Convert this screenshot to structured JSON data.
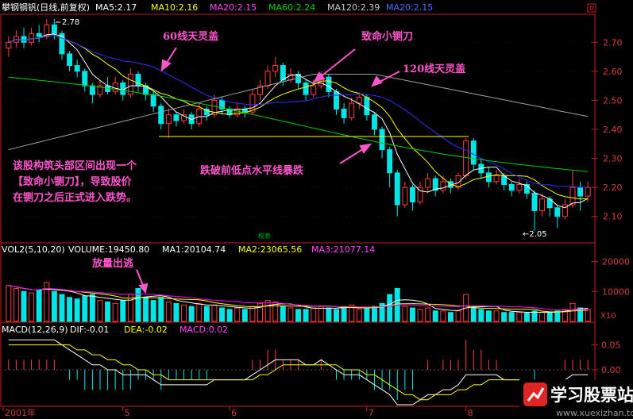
{
  "header": {
    "stock": "攀钢钢钒(日线,前复权)",
    "ma5": "MA5:2.17",
    "ma10": "MA10:2.16",
    "ma20": "MA20:2.15",
    "ma60": "MA60:2.24",
    "ma120": "MA120:2.39",
    "ma20b": "MA20:2.15"
  },
  "volume_header": {
    "label": "VOL2(5,10,20)",
    "volume": "VOLUME:19450.80",
    "ma1": "MA1:20104.74",
    "ma2": "MA2:23065.56",
    "ma3": "MA3:21077.14"
  },
  "macd_header": {
    "label": "MACD(12,26,9)",
    "dif": "DIF:-0.01",
    "dea": "DEA:-0.02",
    "macd": "MACD:0.02"
  },
  "annotations": {
    "a1": "60线天灵盖",
    "a2": "致命小铡刀",
    "a3": "120线天灵盖",
    "a4": "跌破前低点水平线暴跌",
    "note1": "该股构筑头部区间出现一个",
    "note2": "【致命小铡刀】，导致股价",
    "note3": "在铡刀之后正式进入跌势。",
    "vol_note": "放量出逃",
    "high_label": "2.78",
    "low_label": "←2.05",
    "small_mark": "权息",
    "vol_unit": "X10"
  },
  "axis": {
    "price_ticks": [
      "2.70",
      "2.60",
      "2.50",
      "2.40",
      "2.30",
      "2.20",
      "2.10"
    ],
    "vol_ticks": [
      "20000",
      "10000"
    ],
    "macd_ticks": [
      "0.05",
      "0.00",
      "-0.05"
    ],
    "months": [
      "2001年",
      "5",
      "6",
      "7",
      "8",
      "9"
    ]
  },
  "watermark": {
    "title": "学习股票站",
    "url": "www.xuexizhan.top"
  },
  "colors": {
    "bg": "#000000",
    "up": "#ff3c3c",
    "down": "#00e6e6",
    "ma5": "#ffffff",
    "ma10": "#ffff00",
    "ma20": "#ff00ff",
    "ma60": "#00d000",
    "ma120": "#a0a0a0",
    "ma20b": "#3030ff",
    "annotation": "#ff55cc",
    "axis": "#c81e1e"
  },
  "chart_data": {
    "type": "candlestick",
    "price_range": [
      2.02,
      2.78
    ],
    "volume_range": [
      0,
      22000
    ],
    "macd_range": [
      -0.07,
      0.07
    ],
    "candles": [
      [
        2.68,
        2.7,
        2.72,
        2.65
      ],
      [
        2.7,
        2.72,
        2.74,
        2.68
      ],
      [
        2.72,
        2.7,
        2.75,
        2.68
      ],
      [
        2.7,
        2.73,
        2.75,
        2.69
      ],
      [
        2.73,
        2.72,
        2.76,
        2.7
      ],
      [
        2.72,
        2.76,
        2.78,
        2.71
      ],
      [
        2.76,
        2.73,
        2.78,
        2.71
      ],
      [
        2.73,
        2.66,
        2.74,
        2.64
      ],
      [
        2.66,
        2.62,
        2.67,
        2.6
      ],
      [
        2.62,
        2.6,
        2.64,
        2.58
      ],
      [
        2.6,
        2.55,
        2.61,
        2.53
      ],
      [
        2.55,
        2.52,
        2.56,
        2.49
      ],
      [
        2.52,
        2.55,
        2.57,
        2.51
      ],
      [
        2.55,
        2.53,
        2.58,
        2.52
      ],
      [
        2.53,
        2.56,
        2.58,
        2.52
      ],
      [
        2.56,
        2.52,
        2.57,
        2.5
      ],
      [
        2.52,
        2.59,
        2.61,
        2.51
      ],
      [
        2.59,
        2.55,
        2.6,
        2.53
      ],
      [
        2.55,
        2.52,
        2.56,
        2.5
      ],
      [
        2.52,
        2.48,
        2.53,
        2.46
      ],
      [
        2.48,
        2.42,
        2.49,
        2.4
      ],
      [
        2.42,
        2.45,
        2.47,
        2.37
      ],
      [
        2.45,
        2.43,
        2.46,
        2.41
      ],
      [
        2.43,
        2.45,
        2.47,
        2.42
      ],
      [
        2.45,
        2.42,
        2.46,
        2.4
      ],
      [
        2.42,
        2.47,
        2.49,
        2.41
      ],
      [
        2.47,
        2.45,
        2.48,
        2.43
      ],
      [
        2.45,
        2.5,
        2.52,
        2.44
      ],
      [
        2.5,
        2.47,
        2.51,
        2.45
      ],
      [
        2.47,
        2.45,
        2.48,
        2.44
      ],
      [
        2.45,
        2.47,
        2.49,
        2.44
      ],
      [
        2.47,
        2.46,
        2.48,
        2.44
      ],
      [
        2.46,
        2.52,
        2.54,
        2.45
      ],
      [
        2.52,
        2.55,
        2.57,
        2.5
      ],
      [
        2.55,
        2.6,
        2.62,
        2.54
      ],
      [
        2.6,
        2.62,
        2.65,
        2.58
      ],
      [
        2.62,
        2.57,
        2.63,
        2.55
      ],
      [
        2.57,
        2.59,
        2.61,
        2.56
      ],
      [
        2.59,
        2.56,
        2.6,
        2.54
      ],
      [
        2.56,
        2.52,
        2.57,
        2.5
      ],
      [
        2.52,
        2.55,
        2.57,
        2.51
      ],
      [
        2.55,
        2.58,
        2.6,
        2.54
      ],
      [
        2.58,
        2.53,
        2.59,
        2.51
      ],
      [
        2.53,
        2.47,
        2.54,
        2.45
      ],
      [
        2.47,
        2.44,
        2.49,
        2.42
      ],
      [
        2.44,
        2.49,
        2.51,
        2.43
      ],
      [
        2.49,
        2.51,
        2.52,
        2.47
      ],
      [
        2.51,
        2.45,
        2.52,
        2.43
      ],
      [
        2.45,
        2.4,
        2.46,
        2.38
      ],
      [
        2.4,
        2.33,
        2.41,
        2.3
      ],
      [
        2.33,
        2.25,
        2.34,
        2.2
      ],
      [
        2.25,
        2.14,
        2.26,
        2.1
      ],
      [
        2.14,
        2.2,
        2.22,
        2.13
      ],
      [
        2.2,
        2.15,
        2.21,
        2.12
      ],
      [
        2.15,
        2.2,
        2.22,
        2.14
      ],
      [
        2.2,
        2.23,
        2.25,
        2.18
      ],
      [
        2.23,
        2.19,
        2.24,
        2.17
      ],
      [
        2.19,
        2.22,
        2.24,
        2.18
      ],
      [
        2.22,
        2.2,
        2.23,
        2.18
      ],
      [
        2.2,
        2.24,
        2.25,
        2.19
      ],
      [
        2.24,
        2.36,
        2.37,
        2.23
      ],
      [
        2.36,
        2.28,
        2.37,
        2.26
      ],
      [
        2.28,
        2.25,
        2.3,
        2.23
      ],
      [
        2.25,
        2.22,
        2.27,
        2.2
      ],
      [
        2.22,
        2.24,
        2.26,
        2.21
      ],
      [
        2.24,
        2.21,
        2.25,
        2.19
      ],
      [
        2.21,
        2.19,
        2.22,
        2.17
      ],
      [
        2.19,
        2.21,
        2.23,
        2.18
      ],
      [
        2.21,
        2.18,
        2.22,
        2.16
      ],
      [
        2.18,
        2.12,
        2.19,
        2.05
      ],
      [
        2.12,
        2.16,
        2.18,
        2.1
      ],
      [
        2.16,
        2.13,
        2.17,
        2.1
      ],
      [
        2.13,
        2.1,
        2.14,
        2.06
      ],
      [
        2.1,
        2.14,
        2.16,
        2.09
      ],
      [
        2.14,
        2.2,
        2.26,
        2.13
      ],
      [
        2.2,
        2.17,
        2.22,
        2.12
      ],
      [
        2.17,
        2.2,
        2.22,
        2.15
      ]
    ],
    "volume": [
      12000,
      11000,
      10000,
      9500,
      10500,
      13000,
      10000,
      9000,
      8000,
      7500,
      8500,
      9000,
      7000,
      6500,
      6000,
      7000,
      9000,
      11000,
      8000,
      7000,
      8000,
      6500,
      6000,
      5500,
      5000,
      6000,
      5000,
      5500,
      4500,
      4000,
      4500,
      4000,
      5000,
      6000,
      7000,
      6500,
      5000,
      4500,
      4000,
      4000,
      4500,
      5000,
      4500,
      4000,
      5000,
      5500,
      4000,
      4500,
      5000,
      6000,
      9000,
      11000,
      5000,
      4500,
      4000,
      4500,
      3500,
      3500,
      3000,
      3500,
      9000,
      5000,
      4000,
      3500,
      3500,
      3000,
      3000,
      3000,
      2800,
      3500,
      3000,
      2800,
      3500,
      4000,
      6000,
      4500,
      4000
    ],
    "macd_dif": [
      0.06,
      0.06,
      0.06,
      0.06,
      0.06,
      0.06,
      0.06,
      0.05,
      0.04,
      0.03,
      0.02,
      0.01,
      0.01,
      0.0,
      0.0,
      -0.01,
      -0.01,
      -0.01,
      -0.01,
      -0.02,
      -0.03,
      -0.03,
      -0.03,
      -0.03,
      -0.03,
      -0.03,
      -0.03,
      -0.02,
      -0.02,
      -0.02,
      -0.02,
      -0.02,
      -0.01,
      0.0,
      0.01,
      0.02,
      0.02,
      0.02,
      0.02,
      0.01,
      0.01,
      0.02,
      0.01,
      0.0,
      -0.01,
      -0.01,
      -0.01,
      -0.02,
      -0.03,
      -0.04,
      -0.05,
      -0.07,
      -0.07,
      -0.07,
      -0.06,
      -0.05,
      -0.05,
      -0.04,
      -0.04,
      -0.03,
      -0.01,
      -0.01,
      -0.01,
      -0.01,
      -0.01,
      -0.02,
      -0.02,
      -0.02,
      -0.02,
      -0.03,
      -0.03,
      -0.03,
      -0.03,
      -0.02,
      -0.01,
      -0.01,
      -0.01
    ],
    "macd_dea": [
      0.05,
      0.05,
      0.05,
      0.05,
      0.05,
      0.05,
      0.05,
      0.05,
      0.05,
      0.04,
      0.04,
      0.03,
      0.03,
      0.02,
      0.02,
      0.01,
      0.01,
      0.0,
      0.0,
      -0.01,
      -0.01,
      -0.02,
      -0.02,
      -0.02,
      -0.02,
      -0.02,
      -0.02,
      -0.02,
      -0.02,
      -0.02,
      -0.02,
      -0.02,
      -0.02,
      -0.01,
      -0.01,
      0.0,
      0.01,
      0.01,
      0.01,
      0.01,
      0.01,
      0.01,
      0.01,
      0.01,
      0.0,
      0.0,
      0.0,
      -0.01,
      -0.01,
      -0.02,
      -0.03,
      -0.04,
      -0.05,
      -0.05,
      -0.06,
      -0.06,
      -0.05,
      -0.05,
      -0.05,
      -0.04,
      -0.04,
      -0.03,
      -0.03,
      -0.02,
      -0.02,
      -0.02,
      -0.02,
      -0.02,
      -0.02,
      -0.02,
      -0.03,
      -0.03,
      -0.03,
      -0.03,
      -0.02,
      -0.02,
      -0.02
    ]
  }
}
